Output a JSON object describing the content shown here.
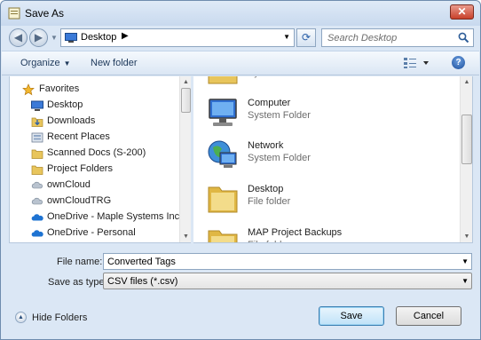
{
  "window": {
    "title": "Save As",
    "close_glyph": "✕"
  },
  "address": {
    "location": "Desktop",
    "separator": "▶",
    "back_glyph": "◀",
    "forward_glyph": "▶",
    "dropdown_glyph": "▼",
    "refresh_glyph": "⟳"
  },
  "search": {
    "placeholder": "Search Desktop"
  },
  "toolbar": {
    "organize_label": "Organize",
    "caret": "▼",
    "new_folder_label": "New folder",
    "help_glyph": "?"
  },
  "nav": {
    "favorites_label": "Favorites",
    "items": [
      {
        "label": "Desktop",
        "icon": "desktop-icon"
      },
      {
        "label": "Downloads",
        "icon": "downloads-icon"
      },
      {
        "label": "Recent Places",
        "icon": "recent-places-icon"
      },
      {
        "label": "Scanned Docs (S-200)",
        "icon": "folder-icon"
      },
      {
        "label": "Project Folders",
        "icon": "folder-icon"
      },
      {
        "label": "ownCloud",
        "icon": "cloud-icon"
      },
      {
        "label": "ownCloudTRG",
        "icon": "cloud-icon"
      },
      {
        "label": "OneDrive - Maple Systems Inc",
        "icon": "onedrive-icon"
      },
      {
        "label": "OneDrive - Personal",
        "icon": "onedrive-icon"
      }
    ]
  },
  "content": {
    "items": [
      {
        "name": "",
        "type": "System Folder",
        "icon": "folder-icon"
      },
      {
        "name": "Computer",
        "type": "System Folder",
        "icon": "computer-icon"
      },
      {
        "name": "Network",
        "type": "System Folder",
        "icon": "network-icon"
      },
      {
        "name": "Desktop",
        "type": "File folder",
        "icon": "folder-icon"
      },
      {
        "name": "MAP Project Backups",
        "type": "File folder",
        "icon": "folder-icon"
      }
    ]
  },
  "form": {
    "file_name_label": "File name:",
    "file_name_value": "Converted Tags",
    "save_type_label": "Save as type:",
    "save_type_value": "CSV files (*.csv)"
  },
  "footer": {
    "hide_folders_label": "Hide Folders",
    "save_label": "Save",
    "cancel_label": "Cancel"
  },
  "colors": {
    "accent": "#3c7fb1",
    "chrome": "#dbe7f5"
  }
}
